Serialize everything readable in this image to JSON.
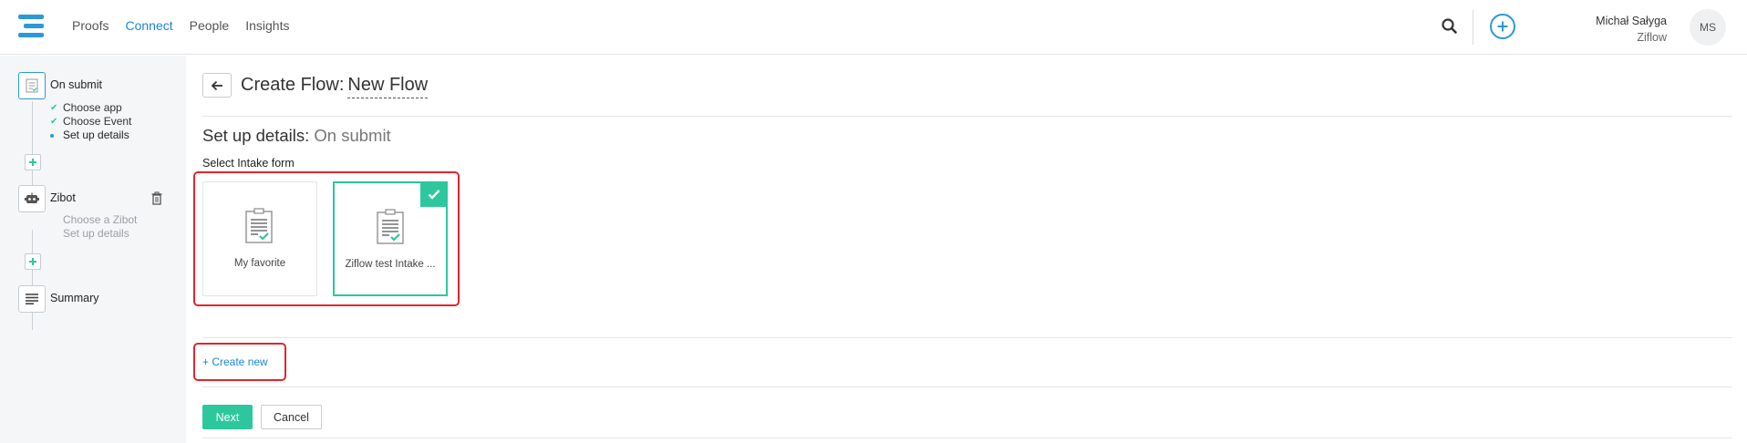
{
  "nav": {
    "items": [
      {
        "label": "Proofs"
      },
      {
        "label": "Connect"
      },
      {
        "label": "People"
      },
      {
        "label": "Insights"
      }
    ],
    "active": "Connect"
  },
  "user": {
    "name": "Michał Sałyga",
    "org": "Ziflow",
    "initials": "MS"
  },
  "sidebar": {
    "steps": [
      {
        "title": "On submit",
        "substeps": [
          {
            "label": "Choose app",
            "state": "done"
          },
          {
            "label": "Choose Event",
            "state": "done"
          },
          {
            "label": "Set up details",
            "state": "active"
          }
        ]
      },
      {
        "title": "Zibot",
        "substeps": [
          {
            "label": "Choose a Zibot",
            "state": "pending"
          },
          {
            "label": "Set up details",
            "state": "pending"
          }
        ]
      },
      {
        "title": "Summary",
        "substeps": []
      }
    ]
  },
  "header": {
    "title": "Create Flow:",
    "flow_name": "New Flow"
  },
  "section": {
    "title": "Set up details:",
    "subtitle": "On submit",
    "select_label": "Select Intake form"
  },
  "forms": [
    {
      "label": "My favorite",
      "selected": false
    },
    {
      "label": "Ziflow test Intake ...",
      "selected": true
    }
  ],
  "actions": {
    "create_new": "+ Create new",
    "next": "Next",
    "cancel": "Cancel"
  },
  "colors": {
    "accent_blue": "#1b87cf",
    "accent_green": "#2dc79d",
    "highlight_red": "#e0262e"
  }
}
